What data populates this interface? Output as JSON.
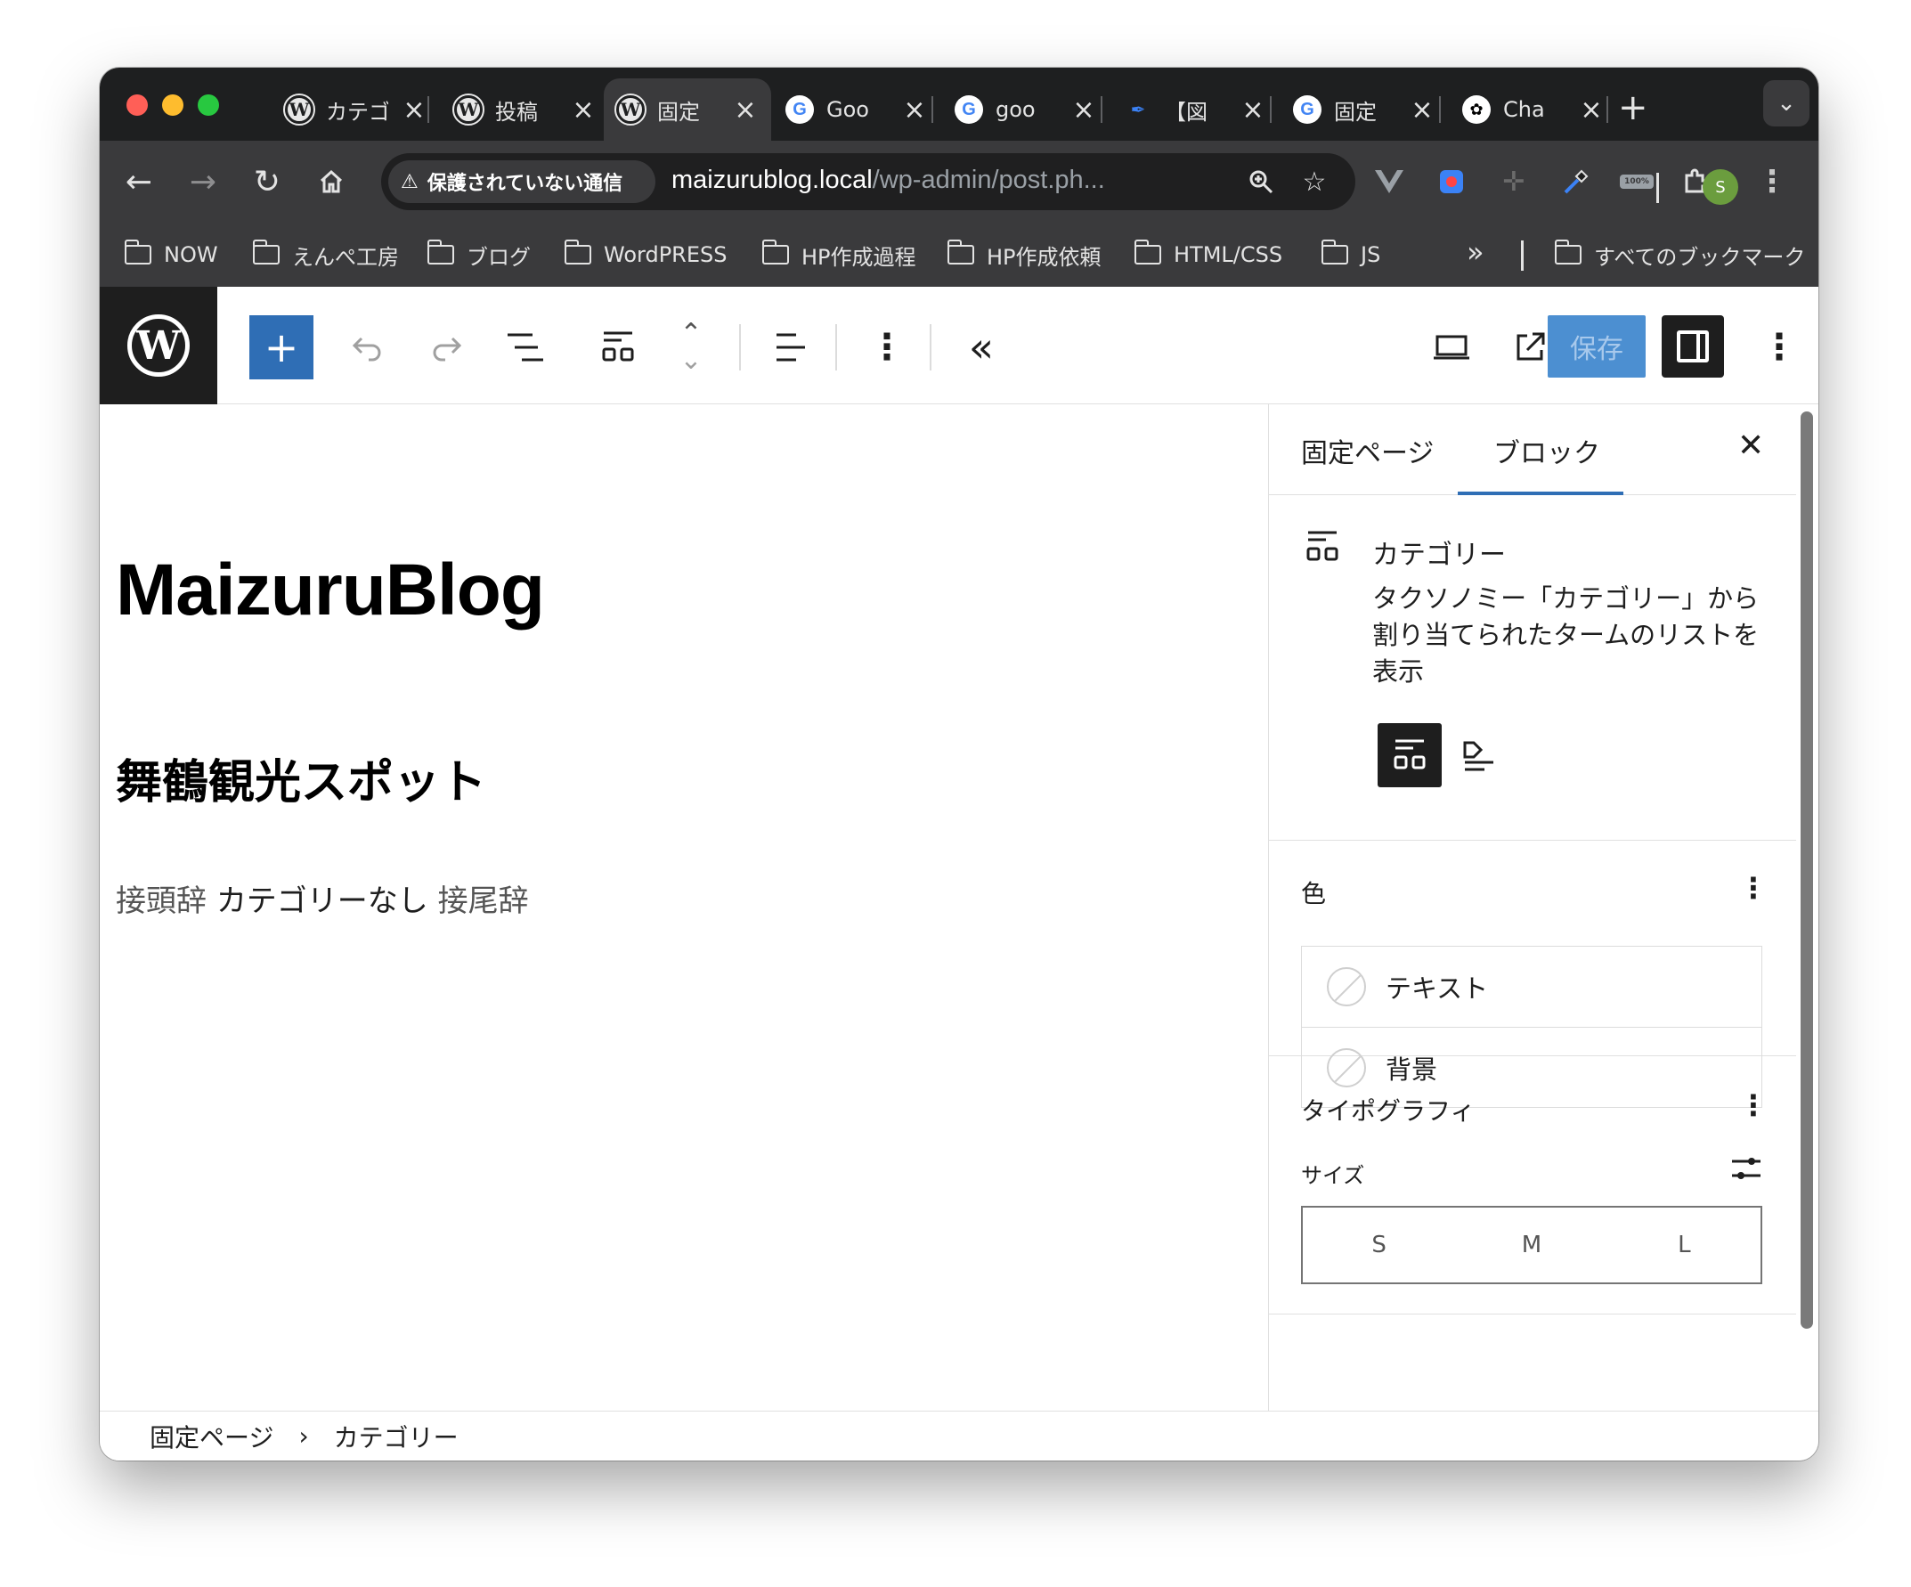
{
  "browser": {
    "tabs": [
      {
        "title": "カテゴ",
        "favicon": "wordpress-icon",
        "active": false
      },
      {
        "title": "投稿",
        "favicon": "wordpress-icon",
        "active": false
      },
      {
        "title": "固定",
        "favicon": "wordpress-icon",
        "active": true
      },
      {
        "title": "Goo",
        "favicon": "google-icon",
        "active": false
      },
      {
        "title": "goo",
        "favicon": "google-icon",
        "active": false
      },
      {
        "title": "【図",
        "favicon": "feather-icon",
        "active": false
      },
      {
        "title": "固定",
        "favicon": "google-icon",
        "active": false
      },
      {
        "title": "Cha",
        "favicon": "chatgpt-icon",
        "active": false
      }
    ],
    "security_chip": "保護されていない通信",
    "url_host": "maizurublog.local",
    "url_path": "/wp-admin/post.ph...",
    "profile_initial": "S",
    "extension_badge": "100%",
    "bookmarks": [
      "NOW",
      "えんぺ工房",
      "ブログ",
      "WordPRESS",
      "HP作成過程",
      "HP作成依頼",
      "HTML/CSS",
      "JS"
    ],
    "all_bookmarks": "すべてのブックマーク"
  },
  "editor": {
    "save_label": "保存",
    "site_title": "MaizuruBlog",
    "page_title": "舞鶴観光スポット",
    "categories_prefix": "接頭辞",
    "categories_value": "カテゴリーなし",
    "categories_suffix": "接尾辞"
  },
  "sidebar": {
    "tab_page": "固定ページ",
    "tab_block": "ブロック",
    "block_name": "カテゴリー",
    "block_description": "タクソノミー「カテゴリー」から割り当てられたタームのリストを表示",
    "color_panel": {
      "title": "色",
      "items": [
        "テキスト",
        "背景"
      ]
    },
    "typography_panel": {
      "title": "タイポグラフィ",
      "size_label": "サイズ",
      "sizes": [
        "S",
        "M",
        "L"
      ]
    }
  },
  "breadcrumb": [
    "固定ページ",
    "カテゴリー"
  ],
  "colors": {
    "accent": "#2f6eb5",
    "save_button": "#4c8fd1",
    "chrome_dark": "#1e1f20",
    "chrome_toolbar": "#3a3a3c"
  }
}
